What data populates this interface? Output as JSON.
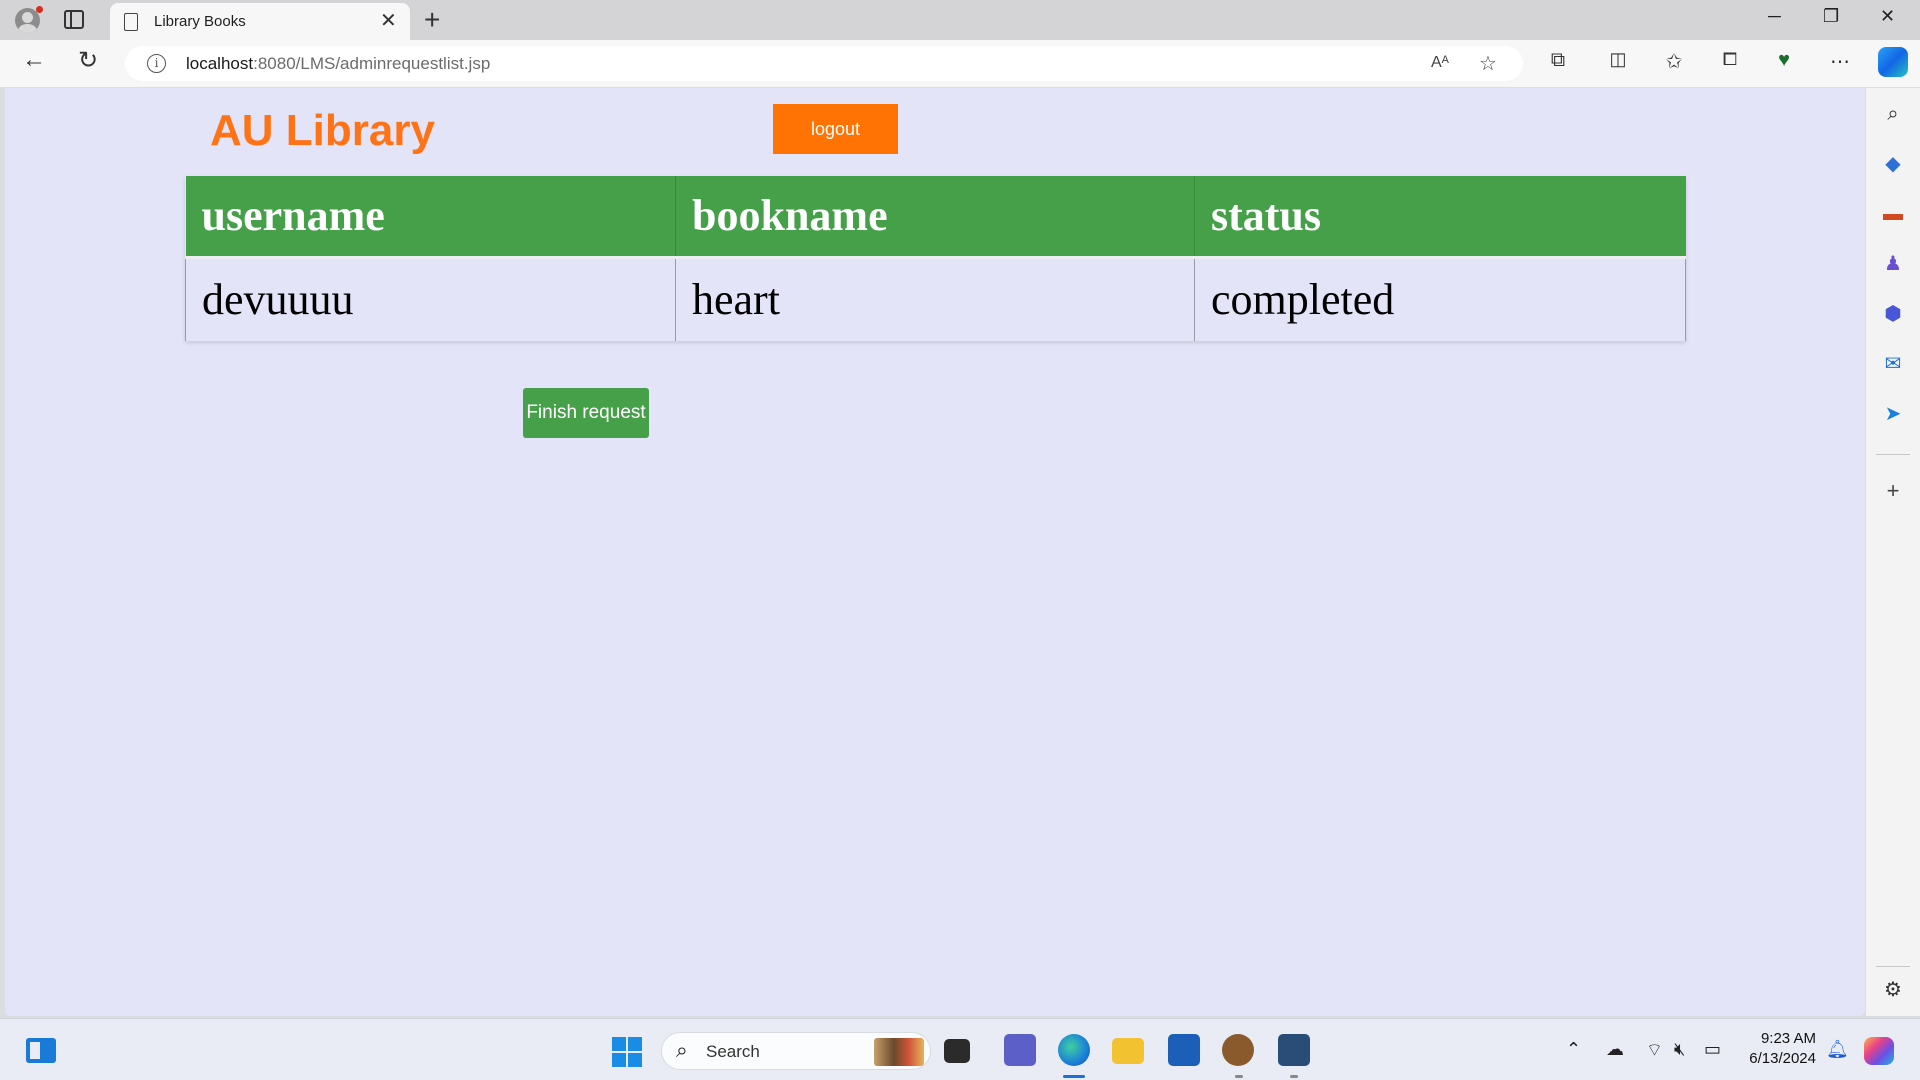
{
  "browser": {
    "tab_title": "Library Books",
    "tab_close": "✕",
    "new_tab": "+",
    "url_host": "localhost",
    "url_path": ":8080/LMS/adminrequestlist.jsp",
    "window_controls": {
      "minimize": "─",
      "restore": "❐",
      "close": "✕"
    }
  },
  "page": {
    "brand": "AU Library",
    "logout_label": "logout",
    "table": {
      "headers": [
        "username",
        "bookname",
        "status"
      ],
      "rows": [
        [
          "devuuuu",
          "heart",
          "completed"
        ]
      ]
    },
    "finish_label": "Finish request"
  },
  "taskbar": {
    "search_label": "Search",
    "time": "9:23 AM",
    "date": "6/13/2024"
  },
  "colors": {
    "brand": "#ff7316",
    "logout_bg": "#ff7304",
    "table_header_bg": "#46a049",
    "page_bg": "#e3e4f8"
  },
  "icons": {
    "edge_sidebar": [
      "search-icon",
      "shopping-tag-icon",
      "tools-icon",
      "games-icon",
      "microsoft365-icon",
      "outlook-icon",
      "drop-icon",
      "add-icon",
      "settings-icon"
    ]
  }
}
